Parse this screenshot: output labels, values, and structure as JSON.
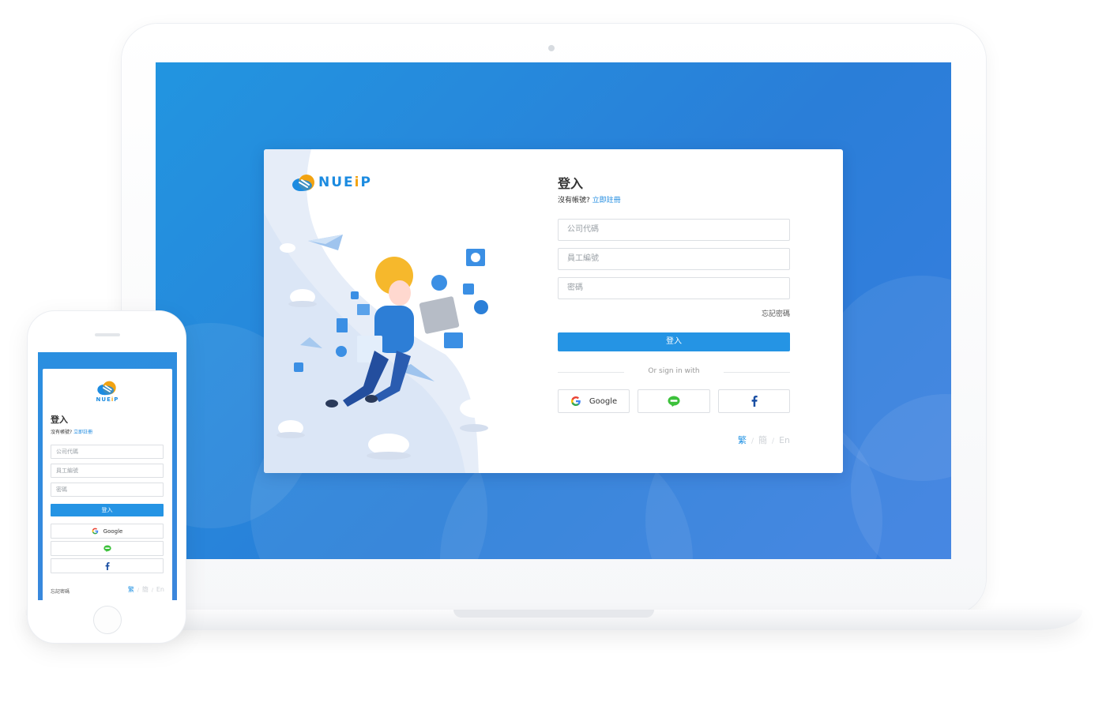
{
  "brand": {
    "name_letters": [
      "N",
      "U",
      "E",
      "i",
      "P"
    ],
    "letter_colors": [
      "#1c8be0",
      "#1c8be0",
      "#1c8be0",
      "#f2a311",
      "#1c8be0"
    ]
  },
  "colors": {
    "primary": "#2594e4",
    "background": "#2a85dc",
    "line_green": "#3cc13b",
    "facebook_blue": "#1a4fa3"
  },
  "login": {
    "title": "登入",
    "no_account": "沒有帳號?",
    "register_link": "立即註冊",
    "company_code_placeholder": "公司代碼",
    "employee_id_placeholder": "員工編號",
    "password_placeholder": "密碼",
    "forgot_password": "忘記密碼",
    "login_button": "登入",
    "or_sign_in_with": "Or sign in with",
    "google_label": "Google",
    "line_icon": "line-icon",
    "facebook_icon": "facebook-icon",
    "lang_trad": "繁",
    "lang_simp": "簡",
    "lang_en": "En",
    "lang_separator": "/"
  }
}
